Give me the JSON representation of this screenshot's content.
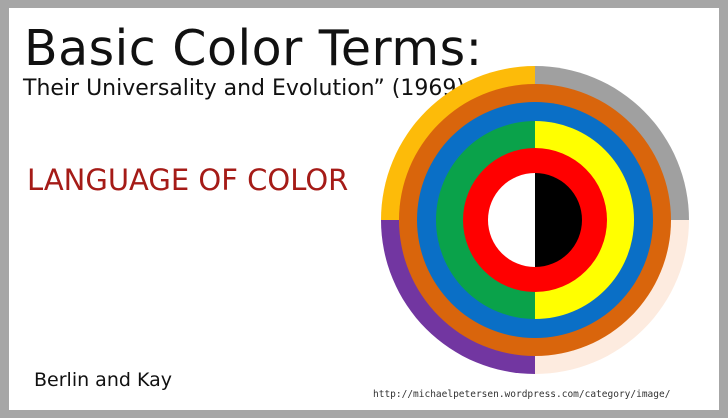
{
  "slide": {
    "title": "Basic Color Terms:",
    "subtitle": "Their Universality and Evolution” (1969).",
    "heading": "LANGUAGE OF COLOR",
    "authors": "Berlin and Kay",
    "source_url": "http://michaelpetersen.wordpress.com/category/image/"
  },
  "colors": {
    "frame": "#a6a6a6",
    "background": "#ffffff",
    "heading": "#a51b17",
    "white": "#ffffff",
    "black": "#000000",
    "red": "#ff0000",
    "green": "#0aa24a",
    "yellow": "#ffff00",
    "blue": "#0a6fc6",
    "brown": "#d9650c",
    "orange": "#fdbb09",
    "gray": "#a0a0a0",
    "pink": "#fdebdf",
    "purple": "#7236a1"
  }
}
